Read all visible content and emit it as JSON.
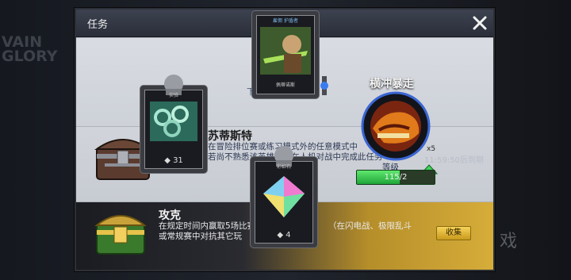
{
  "background": {
    "logo_text": "VAIN GLORY",
    "right_glyph": "戏"
  },
  "modal": {
    "title": "任务"
  },
  "top_card": {
    "label": "雇佣 护盾者",
    "caption": "佩蒂诺斯",
    "behind_text": "下"
  },
  "row1": {
    "chest_card_label": "实验",
    "count": "31"
  },
  "row2": {
    "title": "苏蒂斯特",
    "desc_line1": "在冒险排位赛或练习模式外的任意模式中",
    "desc_line2": "若尚不熟悉该英雄，可在人机对战中完成此任务",
    "desc_trail": "等级",
    "orb_title": "横冲暴走",
    "multiplier": "x5",
    "expire": "11:59:50后到期",
    "progress_text": "115/2",
    "progress_fraction": 0.55
  },
  "row3": {
    "title": "攻克",
    "desc_line1": "在规定时间内赢取5场比赛",
    "desc_line1b": "（在闪电战、极限乱斗",
    "desc_line2": "或常规赛中对抗其它玩",
    "card_label": "彩虹石",
    "count": "4",
    "collect_label": "收集"
  },
  "colors": {
    "accent_green": "#2ec04b",
    "gold": "#d6ad39",
    "header": "#2a2e39"
  }
}
